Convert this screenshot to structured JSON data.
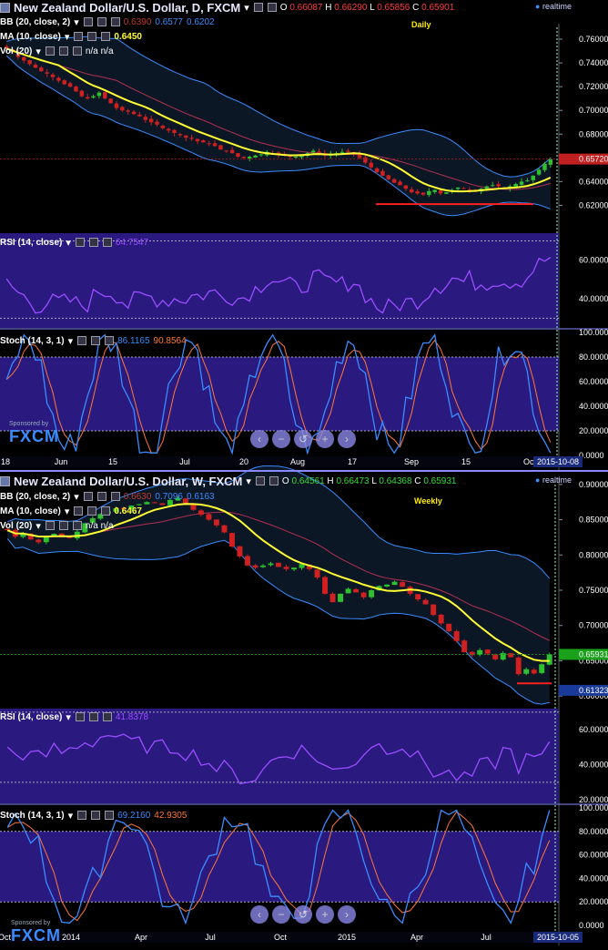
{
  "top": {
    "title": "New Zealand Dollar/U.S. Dollar, D, FXCM",
    "ohlc": {
      "o_label": "O",
      "o": "0.66087",
      "h_label": "H",
      "h": "0.66290",
      "l_label": "L",
      "l": "0.65856",
      "c_label": "C",
      "c": "0.65901"
    },
    "realtime": "realtime",
    "tag": "Daily",
    "bb_label": "BB (20, close, 2)",
    "bb_vals": [
      "0.6390",
      "0.6577",
      "0.6202"
    ],
    "ma_label": "MA (10, close)",
    "ma_val": "0.6450",
    "vol_label": "Vol (20)",
    "vol_vals": "n/a n/a",
    "price_ticks": [
      "0.76000",
      "0.74000",
      "0.72000",
      "0.70000",
      "0.68000",
      "0.66000",
      "0.64000",
      "0.62000"
    ],
    "price_marker": "0.65720",
    "rsi_label": "RSI (14, close)",
    "rsi_val": "64.7547",
    "rsi_ticks": [
      "60.0000",
      "40.0000"
    ],
    "stoch_label": "Stoch (14, 3, 1)",
    "stoch_k": "86.1165",
    "stoch_d": "90.8564",
    "stoch_ticks": [
      "100.0000",
      "80.0000",
      "60.0000",
      "40.0000",
      "20.0000",
      "0.0000"
    ],
    "x_ticks": [
      "18",
      "Jun",
      "15",
      "Jul",
      "20",
      "Aug",
      "17",
      "Sep",
      "15",
      "Oct"
    ],
    "date_box": "2015-10-08",
    "sponsored": "Sponsored by",
    "brand": "FXCM"
  },
  "bottom": {
    "title": "New Zealand Dollar/U.S. Dollar, W, FXCM",
    "ohlc": {
      "o_label": "O",
      "o": "0.64561",
      "h_label": "H",
      "h": "0.66473",
      "l_label": "L",
      "l": "0.64368",
      "c_label": "C",
      "c": "0.65931"
    },
    "realtime": "realtime",
    "tag": "Weekly",
    "bb_label": "BB (20, close, 2)",
    "bb_vals": [
      "0.6630",
      "0.7096",
      "0.6163"
    ],
    "ma_label": "MA (10, close)",
    "ma_val": "0.6467",
    "vol_label": "Vol (20)",
    "vol_vals": "n/a n/a",
    "price_ticks": [
      "0.90000",
      "0.85000",
      "0.80000",
      "0.75000",
      "0.70000",
      "0.65000",
      "0.60000"
    ],
    "price_marker": "0.65931",
    "low_marker": "0.61323",
    "rsi_label": "RSI (14, close)",
    "rsi_val": "41.8378",
    "rsi_ticks": [
      "60.0000",
      "40.0000",
      "20.0000"
    ],
    "stoch_label": "Stoch (14, 3, 1)",
    "stoch_k": "69.2160",
    "stoch_d": "42.9305",
    "stoch_ticks": [
      "100.0000",
      "80.0000",
      "60.0000",
      "40.0000",
      "20.0000",
      "0.0000"
    ],
    "x_ticks": [
      "Oct",
      "2014",
      "Apr",
      "Jul",
      "Oct",
      "2015",
      "Apr",
      "Jul"
    ],
    "date_box": "2015-10-05",
    "sponsored": "Sponsored by",
    "brand": "FXCM"
  },
  "nav_icons": [
    "chevron-left",
    "zoom-out",
    "reset",
    "zoom-in",
    "chevron-right"
  ],
  "colors": {
    "bull": "#2fbf2f",
    "bear": "#d02020",
    "ma": "#ffff33",
    "bb": "#3a8cff",
    "rsi": "#9b4dff",
    "stoch_k": "#3a8cff",
    "stoch_d": "#ff7733",
    "panel": "#2a1a80"
  },
  "chart_data": [
    {
      "type": "candlestick",
      "title": "New Zealand Dollar/U.S. Dollar, D, FXCM",
      "ylim": [
        0.605,
        0.77
      ],
      "close": [
        0.752,
        0.749,
        0.745,
        0.742,
        0.739,
        0.736,
        0.733,
        0.731,
        0.728,
        0.725,
        0.722,
        0.72,
        0.716,
        0.712,
        0.71,
        0.712,
        0.715,
        0.71,
        0.706,
        0.702,
        0.7,
        0.699,
        0.697,
        0.695,
        0.692,
        0.69,
        0.688,
        0.685,
        0.683,
        0.681,
        0.679,
        0.677,
        0.676,
        0.674,
        0.673,
        0.672,
        0.67,
        0.667,
        0.666,
        0.664,
        0.661,
        0.66,
        0.661,
        0.662,
        0.663,
        0.665,
        0.664,
        0.663,
        0.662,
        0.661,
        0.661,
        0.662,
        0.664,
        0.666,
        0.664,
        0.662,
        0.663,
        0.664,
        0.665,
        0.665,
        0.664,
        0.66,
        0.656,
        0.652,
        0.648,
        0.645,
        0.642,
        0.639,
        0.637,
        0.634,
        0.631,
        0.63,
        0.629,
        0.632,
        0.633,
        0.63,
        0.631,
        0.633,
        0.635,
        0.634,
        0.633,
        0.632,
        0.634,
        0.636,
        0.637,
        0.636,
        0.634,
        0.636,
        0.638,
        0.64,
        0.641,
        0.645,
        0.65,
        0.655,
        0.659
      ],
      "ma10_last": 0.645,
      "support_line": 0.621
    },
    {
      "type": "candlestick",
      "title": "New Zealand Dollar/U.S. Dollar, W, FXCM",
      "ylim": [
        0.595,
        0.905
      ],
      "close": [
        0.835,
        0.826,
        0.83,
        0.822,
        0.818,
        0.825,
        0.83,
        0.827,
        0.824,
        0.833,
        0.845,
        0.852,
        0.858,
        0.862,
        0.866,
        0.865,
        0.87,
        0.872,
        0.875,
        0.874,
        0.871,
        0.878,
        0.881,
        0.872,
        0.864,
        0.857,
        0.85,
        0.842,
        0.832,
        0.812,
        0.798,
        0.785,
        0.782,
        0.785,
        0.788,
        0.783,
        0.78,
        0.782,
        0.787,
        0.78,
        0.768,
        0.745,
        0.733,
        0.745,
        0.752,
        0.747,
        0.74,
        0.75,
        0.756,
        0.758,
        0.762,
        0.755,
        0.745,
        0.737,
        0.73,
        0.715,
        0.703,
        0.692,
        0.678,
        0.662,
        0.658,
        0.665,
        0.66,
        0.652,
        0.661,
        0.655,
        0.631,
        0.638,
        0.632,
        0.645,
        0.659
      ],
      "ma10_last": 0.6467,
      "support_line": 0.618
    }
  ]
}
